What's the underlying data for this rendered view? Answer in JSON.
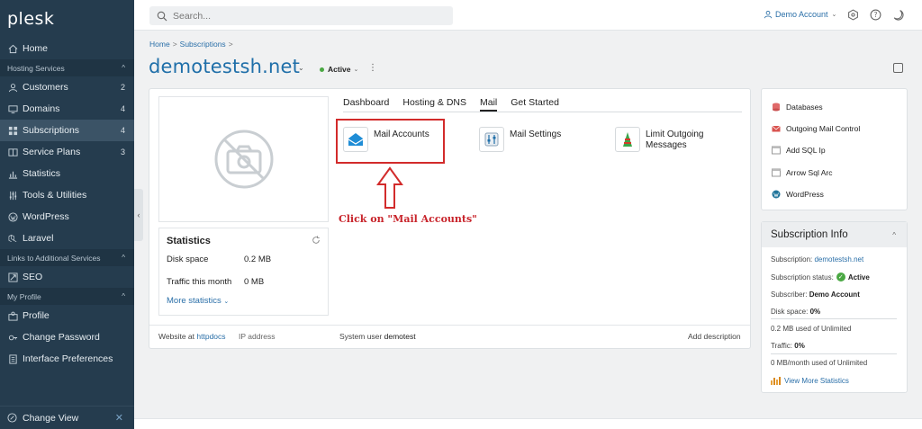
{
  "sidebar": {
    "logo": "plesk",
    "items": [
      {
        "label": "Home"
      },
      {
        "group": "Hosting Services"
      },
      {
        "label": "Customers",
        "count": "2"
      },
      {
        "label": "Domains",
        "count": "4"
      },
      {
        "label": "Subscriptions",
        "count": "4"
      },
      {
        "label": "Service Plans",
        "count": "3"
      },
      {
        "label": "Statistics"
      },
      {
        "label": "Tools & Utilities"
      },
      {
        "label": "WordPress"
      },
      {
        "label": "Laravel"
      },
      {
        "group": "Links to Additional Services"
      },
      {
        "label": "SEO"
      },
      {
        "group": "My Profile"
      },
      {
        "label": "Profile"
      },
      {
        "label": "Change Password"
      },
      {
        "label": "Interface Preferences"
      }
    ],
    "change_view": "Change View"
  },
  "topbar": {
    "search_placeholder": "Search...",
    "account": "Demo Account"
  },
  "breadcrumb": [
    "Home",
    "Subscriptions"
  ],
  "page": {
    "title": "demotestsh.net",
    "status": "Active"
  },
  "stats": {
    "title": "Statistics",
    "disk_label": "Disk space",
    "disk_value": "0.2 MB",
    "traffic_label": "Traffic this month",
    "traffic_value": "0 MB",
    "more": "More statistics"
  },
  "tabs": [
    "Dashboard",
    "Hosting & DNS",
    "Mail",
    "Get Started"
  ],
  "tools": {
    "mail_accounts": "Mail Accounts",
    "mail_settings": "Mail Settings",
    "limit_outgoing_1": "Limit Outgoing",
    "limit_outgoing_2": "Messages"
  },
  "callout": "Click on \"Mail Accounts\"",
  "footer": {
    "website_prefix": "Website at",
    "website_link": "httpdocs",
    "ip_label": "IP address",
    "sysuser_prefix": "System user",
    "sysuser": "demotest",
    "add_description": "Add description"
  },
  "side_links": [
    "Databases",
    "Outgoing Mail Control",
    "Add SQL Ip",
    "Arrow Sql Arc",
    "WordPress"
  ],
  "info": {
    "title": "Subscription Info",
    "subscription_label": "Subscription:",
    "subscription_value": "demotestsh.net",
    "status_label": "Subscription status:",
    "status_value": "Active",
    "subscriber_label": "Subscriber:",
    "subscriber_value": "Demo Account",
    "disk_label": "Disk space:",
    "disk_value": "0%",
    "disk_used": "0.2 MB used of Unlimited",
    "traffic_label": "Traffic:",
    "traffic_value": "0%",
    "traffic_used": "0 MB/month used of Unlimited",
    "view_more": "View More Statistics"
  },
  "colors": {
    "sidebar_bg": "#253c4e",
    "accent": "#1f6fa9",
    "highlight_red": "#d22b2b",
    "active_green": "#4aa843"
  }
}
